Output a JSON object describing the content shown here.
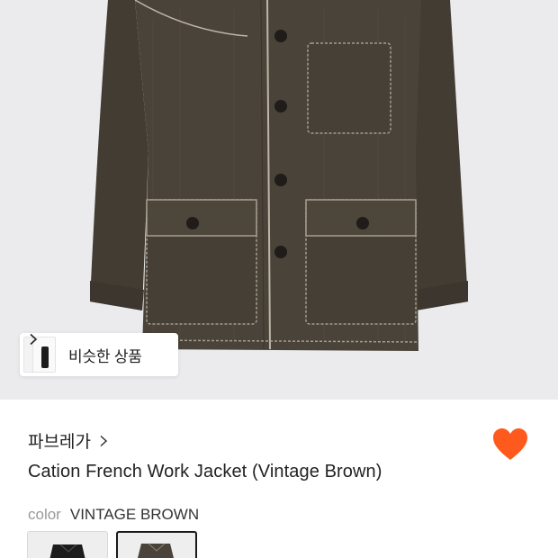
{
  "similar": {
    "label": "비슷한 상품"
  },
  "product": {
    "brand": "파브레가",
    "name": "Cation French Work Jacket (Vintage Brown)",
    "liked": true,
    "color_label": "color",
    "color_value": "VINTAGE BROWN",
    "swatches": [
      {
        "name": "BLACK",
        "selected": false
      },
      {
        "name": "VINTAGE BROWN",
        "selected": true
      }
    ]
  },
  "colors": {
    "accent": "#ff5a1e",
    "jacket": "#4a4339",
    "background": "#ebebed"
  },
  "icons": [
    "chevron-right-icon",
    "heart-icon"
  ]
}
